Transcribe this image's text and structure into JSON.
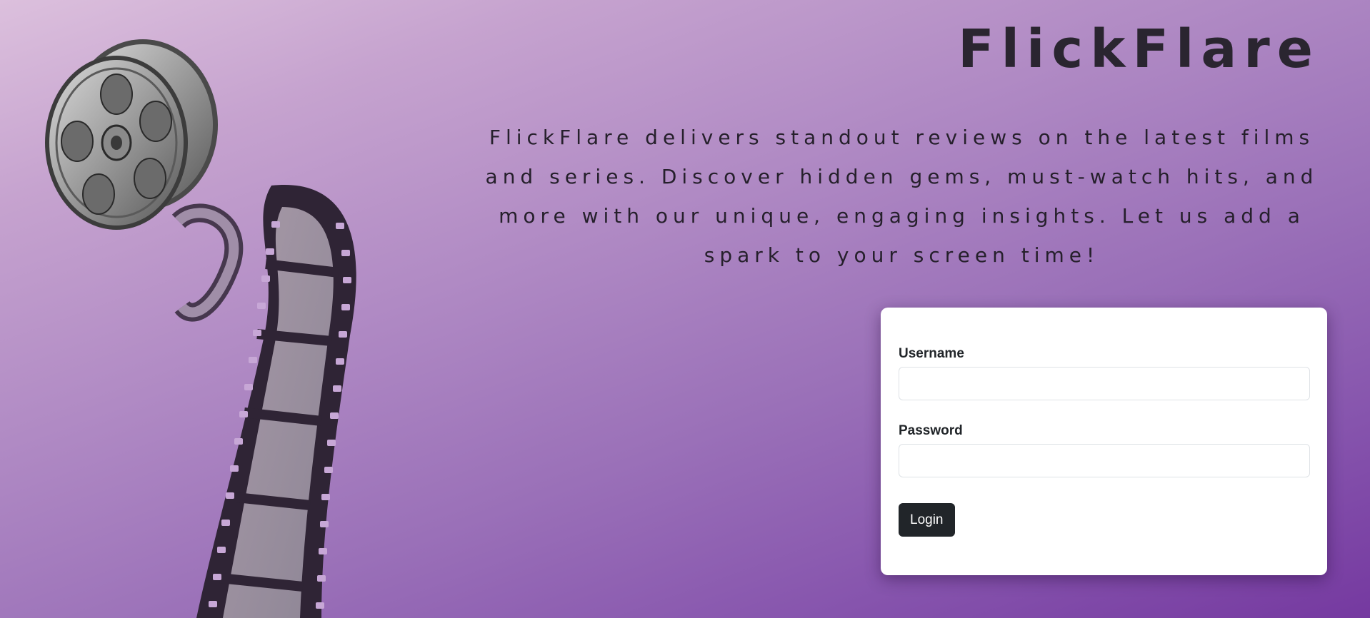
{
  "header": {
    "title": "FlickFlare"
  },
  "hero": {
    "tagline": "FlickFlare delivers standout reviews on the latest films and series. Discover hidden gems, must-watch hits, and more with our unique, engaging insights. Let us add a spark to your screen time!",
    "illustration_icon": "film-reel-icon"
  },
  "login_form": {
    "username_label": "Username",
    "username_value": "",
    "password_label": "Password",
    "password_value": "",
    "submit_label": "Login"
  },
  "colors": {
    "gradient_start": "#dcc0dd",
    "gradient_end": "#7539a0",
    "button_bg": "#212529",
    "text_dark": "#26202c"
  }
}
